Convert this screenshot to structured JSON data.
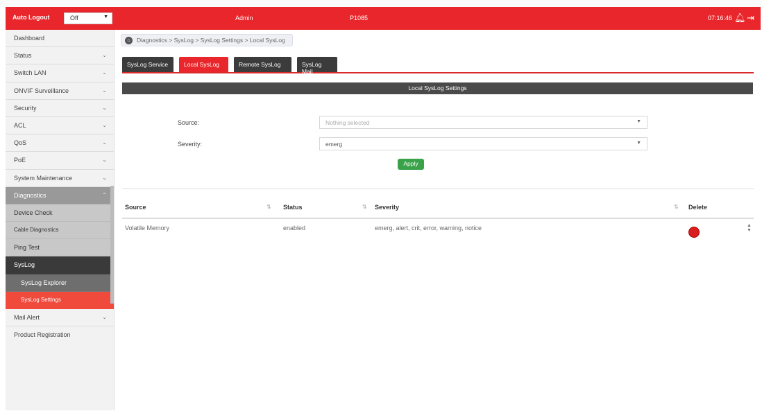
{
  "topbar": {
    "auto_logout_label": "Auto Logout",
    "auto_logout_value": "Off",
    "user": "Admin",
    "model": "P1085",
    "time": "07:16:46",
    "bell_icon": "bell-icon",
    "logout_icon": "logout-icon",
    "accent_color": "#e8262b"
  },
  "sidebar": {
    "items": [
      {
        "label": "Dashboard"
      },
      {
        "label": "Status"
      },
      {
        "label": "Switch LAN"
      },
      {
        "label": "ONVIF Surveillance"
      },
      {
        "label": "Security"
      },
      {
        "label": "ACL"
      },
      {
        "label": "QoS"
      },
      {
        "label": "PoE"
      },
      {
        "label": "System Maintenance"
      },
      {
        "label": "Diagnostics"
      },
      {
        "label": "Device Check"
      },
      {
        "label": "Cable Diagnostics"
      },
      {
        "label": "Ping Test"
      },
      {
        "label": "SysLog"
      },
      {
        "label": "SysLog Explorer"
      },
      {
        "label": "SysLog Settings"
      },
      {
        "label": "Mail Alert"
      },
      {
        "label": "Product Registration"
      }
    ]
  },
  "breadcrumb": {
    "text": "Diagnostics > SysLog > SysLog Settings > Local SysLog"
  },
  "tabs": [
    {
      "label": "SysLog Service"
    },
    {
      "label": "Local SysLog"
    },
    {
      "label": "Remote SysLog"
    },
    {
      "label": "SysLog Mail"
    }
  ],
  "section": {
    "title": "Local SysLog Settings"
  },
  "form": {
    "source_label": "Source:",
    "source_placeholder": "Nothing selected",
    "severity_label": "Severity:",
    "severity_value": "emerg",
    "apply_label": "Apply"
  },
  "table": {
    "headers": {
      "source": "Source",
      "status": "Status",
      "severity": "Severity",
      "delete": "Delete"
    },
    "rows": [
      {
        "source": "Volatile Memory",
        "status": "enabled",
        "severity": "emerg, alert, crit, error, warning, notice"
      }
    ]
  }
}
